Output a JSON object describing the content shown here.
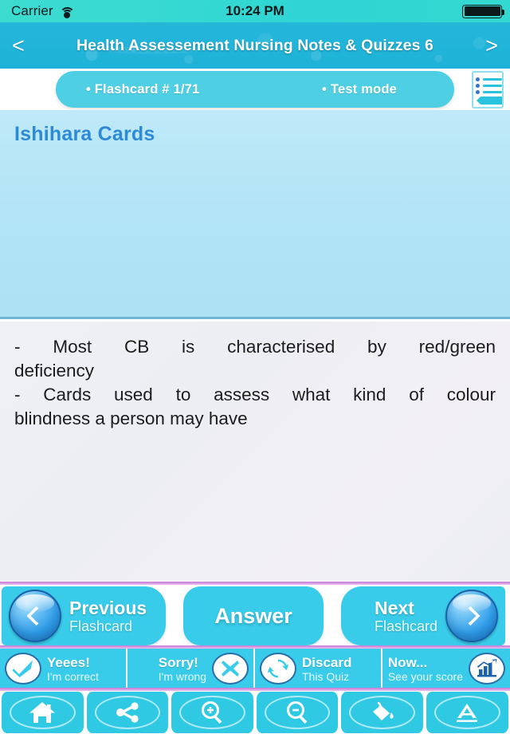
{
  "statusbar": {
    "carrier": "Carrier",
    "wifi_icon": "wifi-icon",
    "time": "10:24 PM",
    "battery_icon": "battery-full-icon"
  },
  "header": {
    "back_label": "<",
    "forward_label": ">",
    "title": "Health Assessement Nursing Notes & Quizzes 6"
  },
  "infobar": {
    "flashcard_counter": "• Flashcard #  1/71",
    "mode": "• Test mode",
    "notes_icon": "notes-list-icon"
  },
  "question": {
    "title": "Ishihara Cards"
  },
  "answer": {
    "line1": "-  Most  CB  is  characterised  by  red/green",
    "line2": "deficiency",
    "line3": "-  Cards  used  to  assess  what  kind  of  colour",
    "line4": "blindness a person may have"
  },
  "nav": {
    "previous": {
      "line1": "Previous",
      "line2": "Flashcard",
      "icon": "chevron-left-icon"
    },
    "answer": {
      "label": "Answer"
    },
    "next": {
      "line1": "Next",
      "line2": "Flashcard",
      "icon": "chevron-right-icon"
    }
  },
  "judge": [
    {
      "line1": "Yeees!",
      "line2": "I'm correct",
      "icon": "check-icon",
      "side": "left"
    },
    {
      "line1": "Sorry!",
      "line2": "I'm wrong",
      "icon": "cross-icon",
      "side": "right"
    },
    {
      "line1": "Discard",
      "line2": "This Quiz",
      "icon": "refresh-icon",
      "side": "left"
    },
    {
      "line1": "Now...",
      "line2": "See your score",
      "icon": "bar-chart-icon",
      "side": "right"
    }
  ],
  "toolbar": [
    {
      "icon": "home-icon"
    },
    {
      "icon": "share-icon"
    },
    {
      "icon": "zoom-in-icon"
    },
    {
      "icon": "zoom-out-icon"
    },
    {
      "icon": "paint-bucket-icon"
    },
    {
      "icon": "font-size-icon"
    }
  ],
  "colors": {
    "status_bar": "#33d8d0",
    "header": "#21b4d9",
    "accent_cyan": "#39ccea",
    "pill": "#4ecfe4",
    "question_bg": "#b2e4f5",
    "question_title": "#2c8ad6",
    "answer_bg": "#eef0f4",
    "separator": "#d08ade",
    "button_blue": "#2f9be8"
  }
}
